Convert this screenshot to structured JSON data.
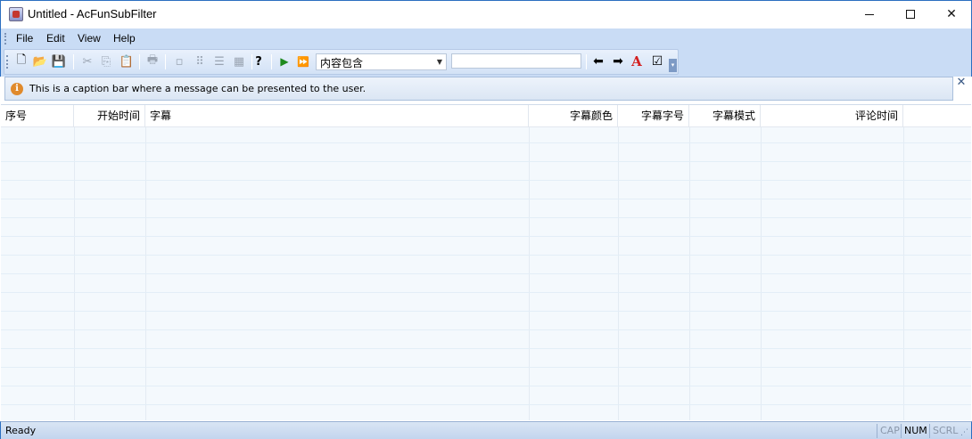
{
  "window": {
    "title": "Untitled - AcFunSubFilter",
    "minimize": "—",
    "maximize": "☐",
    "close": "✕"
  },
  "menu": [
    "File",
    "Edit",
    "View",
    "Help"
  ],
  "toolbar": {
    "combo_value": "内容包含",
    "combo_arrow": "▼",
    "search_value": "",
    "glyphs": {
      "new": "🗋",
      "open": "📂",
      "save": "💾",
      "cut": "✂",
      "copy": "⎘",
      "paste": "📋",
      "print": "🖶",
      "large_icons": "▫",
      "small_icons": "⠿",
      "list": "☰",
      "details": "▦",
      "help": "?",
      "play": "▶",
      "play_all": "⏩",
      "back": "⬅",
      "forward": "➡",
      "font": "A",
      "check": "☑",
      "overflow": "▾"
    }
  },
  "caption_bar": {
    "icon": "i",
    "message": "This is a caption bar where a message can be presented to the user.",
    "close": "✕"
  },
  "list": {
    "columns": [
      "序号",
      "开始时间",
      "字幕",
      "字幕颜色",
      "字幕字号",
      "字幕模式",
      "评论时间"
    ],
    "row_count": 16
  },
  "status": {
    "text": "Ready",
    "indicators": [
      "CAP",
      "NUM",
      "SCRL"
    ],
    "grip": "⋰"
  },
  "colors": {
    "accent": "#2b6fc0",
    "chrome": "#c9dcf5",
    "list_bg": "#f4f9fd",
    "info_icon": "#e08a2c",
    "play_green": "#1e8a1e",
    "play_red": "#d11a1a",
    "font_red": "#d32020"
  }
}
